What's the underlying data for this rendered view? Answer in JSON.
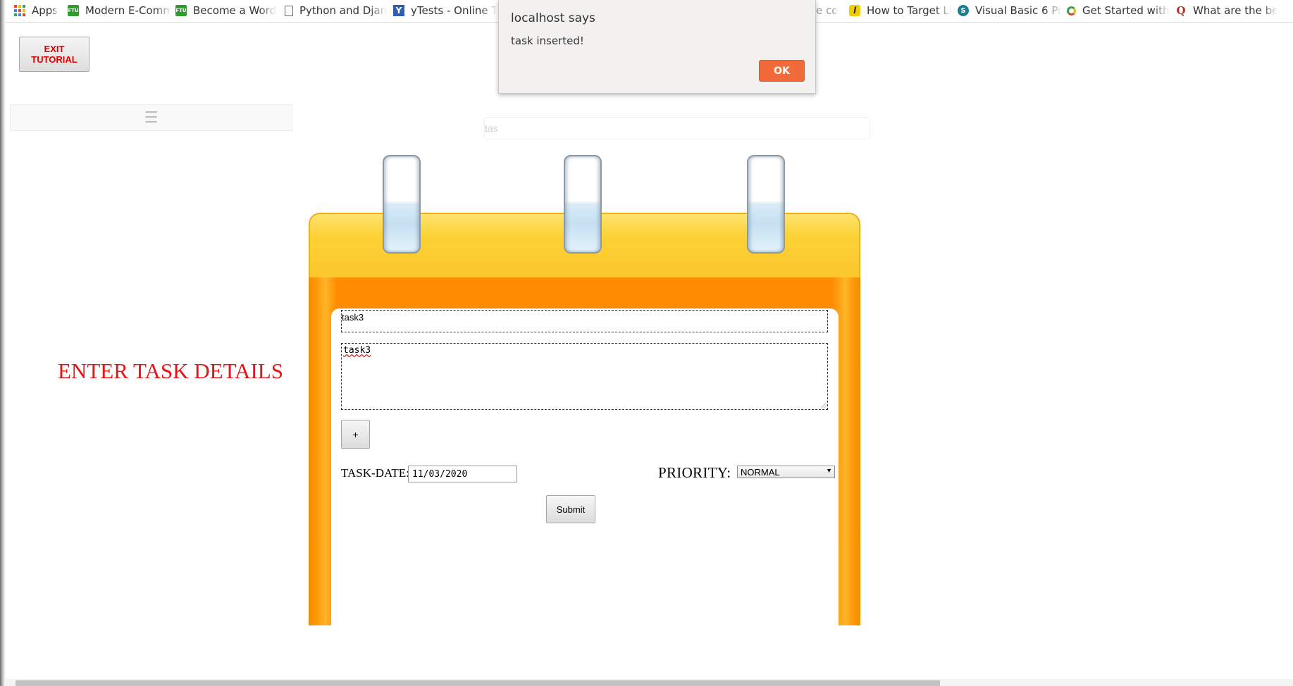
{
  "bookmarks": [
    {
      "label": "Apps",
      "icon": "apps-grid-icon"
    },
    {
      "label": "Modern E-Comm",
      "icon": "ftu-icon"
    },
    {
      "label": "Become a Word",
      "icon": "ftu-icon"
    },
    {
      "label": "Python and Djan",
      "icon": "page-icon"
    },
    {
      "label": "yTests - Online T",
      "icon": "ytests-icon"
    },
    {
      "label": "e co",
      "icon": ""
    },
    {
      "label": "How to Target Li",
      "icon": "l-logo-icon"
    },
    {
      "label": "Visual Basic 6 Pr",
      "icon": "vb-icon"
    },
    {
      "label": "Get Started with",
      "icon": "google-icon"
    },
    {
      "label": "What are the be",
      "icon": "quora-icon"
    }
  ],
  "exit_button": {
    "line1": "EXIT",
    "line2": "TUTORIAL"
  },
  "menu": {
    "icon": "hamburger-icon",
    "glyph": "☰"
  },
  "search": {
    "value": "tas"
  },
  "heading": "ENTER TASK DETAILS",
  "form": {
    "title_value": "task3",
    "description_value": "task3",
    "add_button": "+",
    "date_label": "TASK-DATE:",
    "date_value": "11/03/2020",
    "priority_label": "PRIORITY:",
    "priority_value": "NORMAL",
    "submit_label": "Submit"
  },
  "alert": {
    "title": "localhost says",
    "message": "task inserted!",
    "ok_label": "OK"
  },
  "colors": {
    "heading": "#ee1111",
    "pad_orange": "#ff8c00",
    "pad_yellow": "#fcd235",
    "alert_ok": "#f26a39"
  }
}
